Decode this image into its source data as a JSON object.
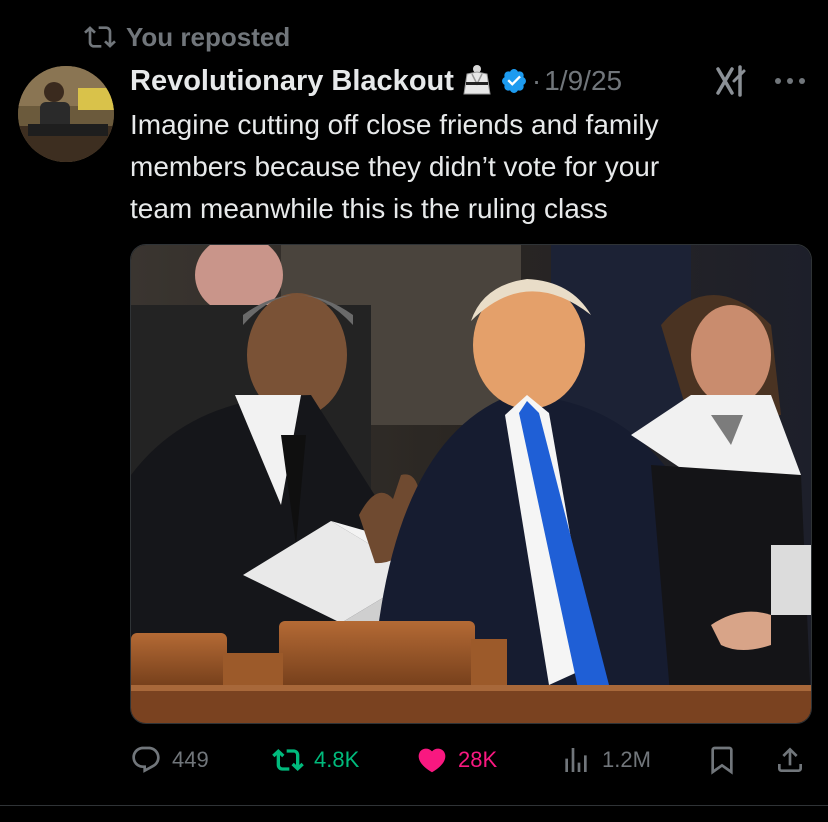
{
  "repost": {
    "label": "You reposted",
    "icon": "repost-icon"
  },
  "author": {
    "display_name": "Revolutionary Blackout",
    "badge_icon": "gi-uniform-emoji",
    "verified_icon": "verified-badge-icon",
    "verified_color": "#1d9bf0",
    "date": "1/9/25"
  },
  "tweet": {
    "text": "Imagine cutting off close friends and family\nmembers because they didn’t vote for your\nteam meanwhile this is the ruling class"
  },
  "actions": {
    "reply_count": "449",
    "repost_count": "4.8K",
    "like_count": "28K",
    "views_count": "1.2M"
  },
  "colors": {
    "background": "#000000",
    "secondary_text": "#71767b",
    "repost_active": "#00ba7c",
    "like_active": "#f91880"
  }
}
